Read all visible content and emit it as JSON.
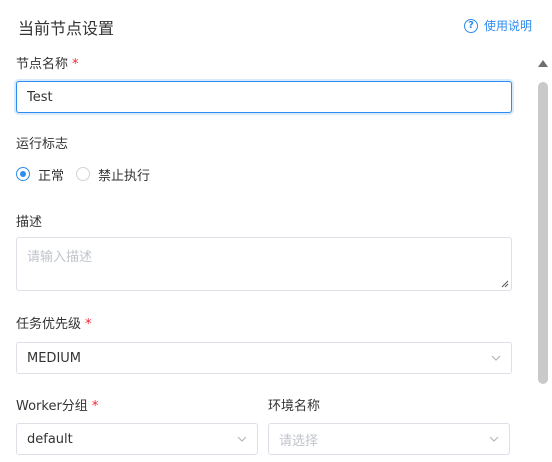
{
  "header": {
    "title": "当前节点设置",
    "help_label": "使用说明",
    "help_icon": "question-circle-icon"
  },
  "form": {
    "node_name": {
      "label": "节点名称",
      "required_mark": "*",
      "value": "Test"
    },
    "run_flag": {
      "label": "运行标志",
      "options": [
        {
          "label": "正常",
          "checked": true
        },
        {
          "label": "禁止执行",
          "checked": false
        }
      ]
    },
    "description": {
      "label": "描述",
      "placeholder": "请输入描述"
    },
    "task_priority": {
      "label": "任务优先级",
      "required_mark": "*",
      "value": "MEDIUM"
    },
    "worker_group": {
      "label": "Worker分组",
      "required_mark": "*",
      "value": "default"
    },
    "env_name": {
      "label": "环境名称",
      "placeholder": "请选择"
    }
  },
  "colors": {
    "accent": "#2d8cf0",
    "required": "#f5222d",
    "border": "#dcdfe6",
    "placeholder": "#c0c4cc"
  }
}
